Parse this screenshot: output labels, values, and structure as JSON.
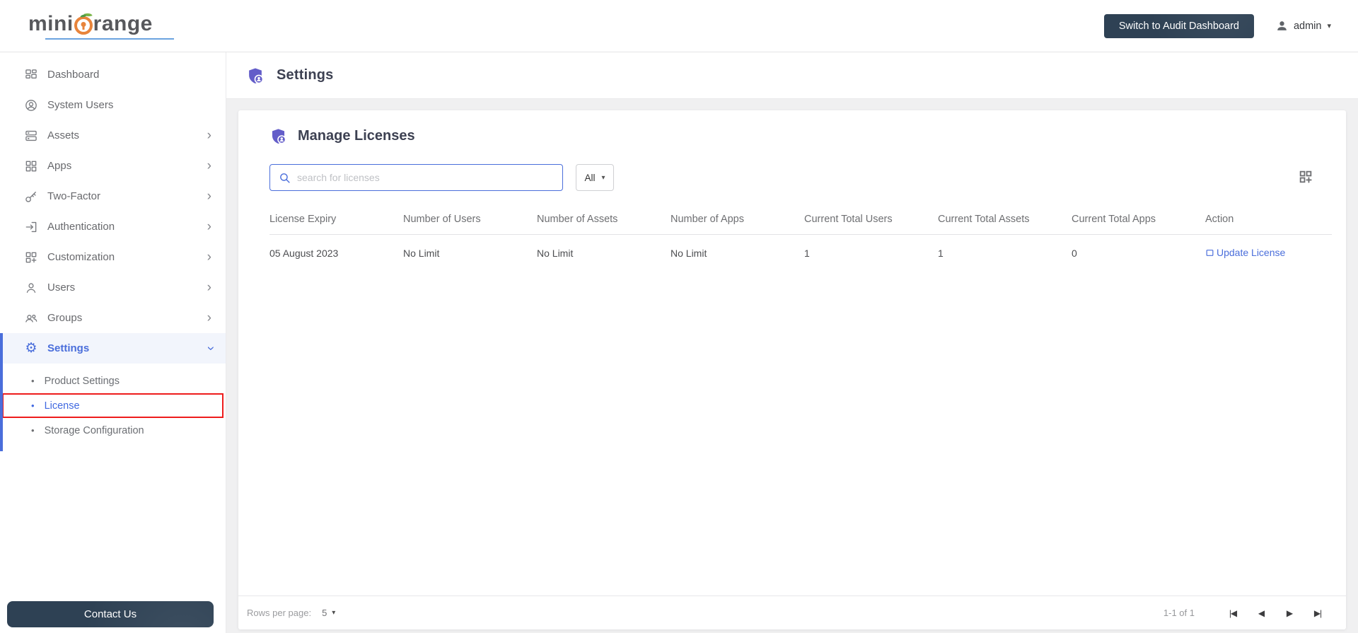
{
  "colors": {
    "accent": "#4a6edb",
    "purple": "#635dc9",
    "navy": "#2e4154",
    "highlight_red": "#ee1c1c"
  },
  "topbar": {
    "logo_mini": "mini",
    "logo_range": "range",
    "switch_button": "Switch to Audit Dashboard",
    "username": "admin"
  },
  "sidebar": {
    "items": [
      {
        "label": "Dashboard",
        "icon": "dashboard",
        "has_submenu": false
      },
      {
        "label": "System Users",
        "icon": "system-users",
        "has_submenu": false
      },
      {
        "label": "Assets",
        "icon": "assets",
        "has_submenu": true
      },
      {
        "label": "Apps",
        "icon": "apps",
        "has_submenu": true
      },
      {
        "label": "Two-Factor",
        "icon": "two-factor",
        "has_submenu": true
      },
      {
        "label": "Authentication",
        "icon": "authentication",
        "has_submenu": true
      },
      {
        "label": "Customization",
        "icon": "customization",
        "has_submenu": true
      },
      {
        "label": "Users",
        "icon": "users",
        "has_submenu": true
      },
      {
        "label": "Groups",
        "icon": "groups",
        "has_submenu": true
      }
    ],
    "settings": {
      "label": "Settings",
      "icon": "settings",
      "expanded": true,
      "submenu": [
        {
          "label": "Product Settings",
          "highlighted": false,
          "active": false
        },
        {
          "label": "License",
          "highlighted": true,
          "active": true
        },
        {
          "label": "Storage Configuration",
          "highlighted": false,
          "active": false
        }
      ]
    },
    "contact_button": "Contact Us"
  },
  "page": {
    "title": "Settings"
  },
  "license_card": {
    "title": "Manage Licenses",
    "search_placeholder": "search for licenses",
    "filter_value": "All",
    "table": {
      "columns": [
        "License Expiry",
        "Number of Users",
        "Number of Assets",
        "Number of Apps",
        "Current Total Users",
        "Current Total Assets",
        "Current Total Apps",
        "Action"
      ],
      "rows": [
        {
          "license_expiry": "05 August 2023",
          "number_of_users": "No Limit",
          "number_of_assets": "No Limit",
          "number_of_apps": "No Limit",
          "current_total_users": "1",
          "current_total_assets": "1",
          "current_total_apps": "0",
          "action": "Update License"
        }
      ]
    },
    "pagination": {
      "rows_per_page_label": "Rows per page:",
      "rows_per_page_value": "5",
      "range": "1-1 of 1"
    }
  }
}
